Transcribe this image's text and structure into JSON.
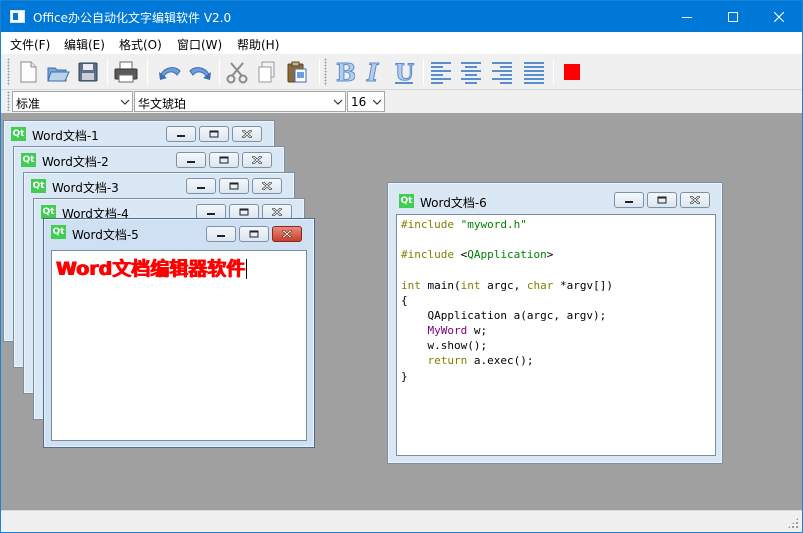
{
  "window": {
    "title": "Office办公自动化文字编辑软件 V2.0",
    "controls": [
      "minimize",
      "maximize",
      "close"
    ]
  },
  "menu": {
    "items": [
      {
        "label": "文件(F)"
      },
      {
        "label": "编辑(E)"
      },
      {
        "label": "格式(O)"
      },
      {
        "label": "窗口(W)"
      },
      {
        "label": "帮助(H)"
      }
    ]
  },
  "toolbar": {
    "buttons": [
      {
        "name": "new-file-icon"
      },
      {
        "name": "open-file-icon"
      },
      {
        "name": "save-icon"
      },
      {
        "name": "print-icon"
      },
      {
        "name": "undo-icon"
      },
      {
        "name": "redo-icon"
      },
      {
        "name": "cut-icon"
      },
      {
        "name": "copy-icon"
      },
      {
        "name": "paste-icon"
      },
      {
        "name": "bold-icon",
        "glyph": "B"
      },
      {
        "name": "italic-icon",
        "glyph": "I"
      },
      {
        "name": "underline-icon",
        "glyph": "U"
      },
      {
        "name": "align-left-icon"
      },
      {
        "name": "align-center-icon"
      },
      {
        "name": "align-right-icon"
      },
      {
        "name": "align-justify-icon"
      },
      {
        "name": "color-icon",
        "color": "#ff0000"
      }
    ]
  },
  "format": {
    "style": "标准",
    "font": "华文琥珀",
    "size": "16"
  },
  "subwindows": [
    {
      "title": "Word文档-1"
    },
    {
      "title": "Word文档-2"
    },
    {
      "title": "Word文档-3"
    },
    {
      "title": "Word文档-4"
    },
    {
      "title": "Word文档-5",
      "text": "Word文档编辑器软件"
    },
    {
      "title": "Word文档-6"
    }
  ],
  "code": {
    "l1_kw": "#include",
    "l1_rest": " \"myword.h\"",
    "l2_kw": "#include",
    "l2_lt": " <",
    "l2_cls": "QApplication",
    "l2_gt": ">",
    "l3_int1": "int",
    "l3_a": " main(",
    "l3_int2": "int",
    "l3_b": " argc, ",
    "l3_char": "char",
    "l3_c": " *argv[])",
    "l4": "{",
    "l5": "    QApplication a(argc, argv);",
    "l6_cls": "MyWord",
    "l6_rest": " w;",
    "l7": "    w.show();",
    "l8_kw": "return",
    "l8_rest": " a.exec();",
    "l9": "}"
  },
  "colors": {
    "titlebar": "#0078d7",
    "mdi_background": "#a0a0a0",
    "accent_red": "#ff0000",
    "toolbar_blue": "#5a8fcf"
  }
}
